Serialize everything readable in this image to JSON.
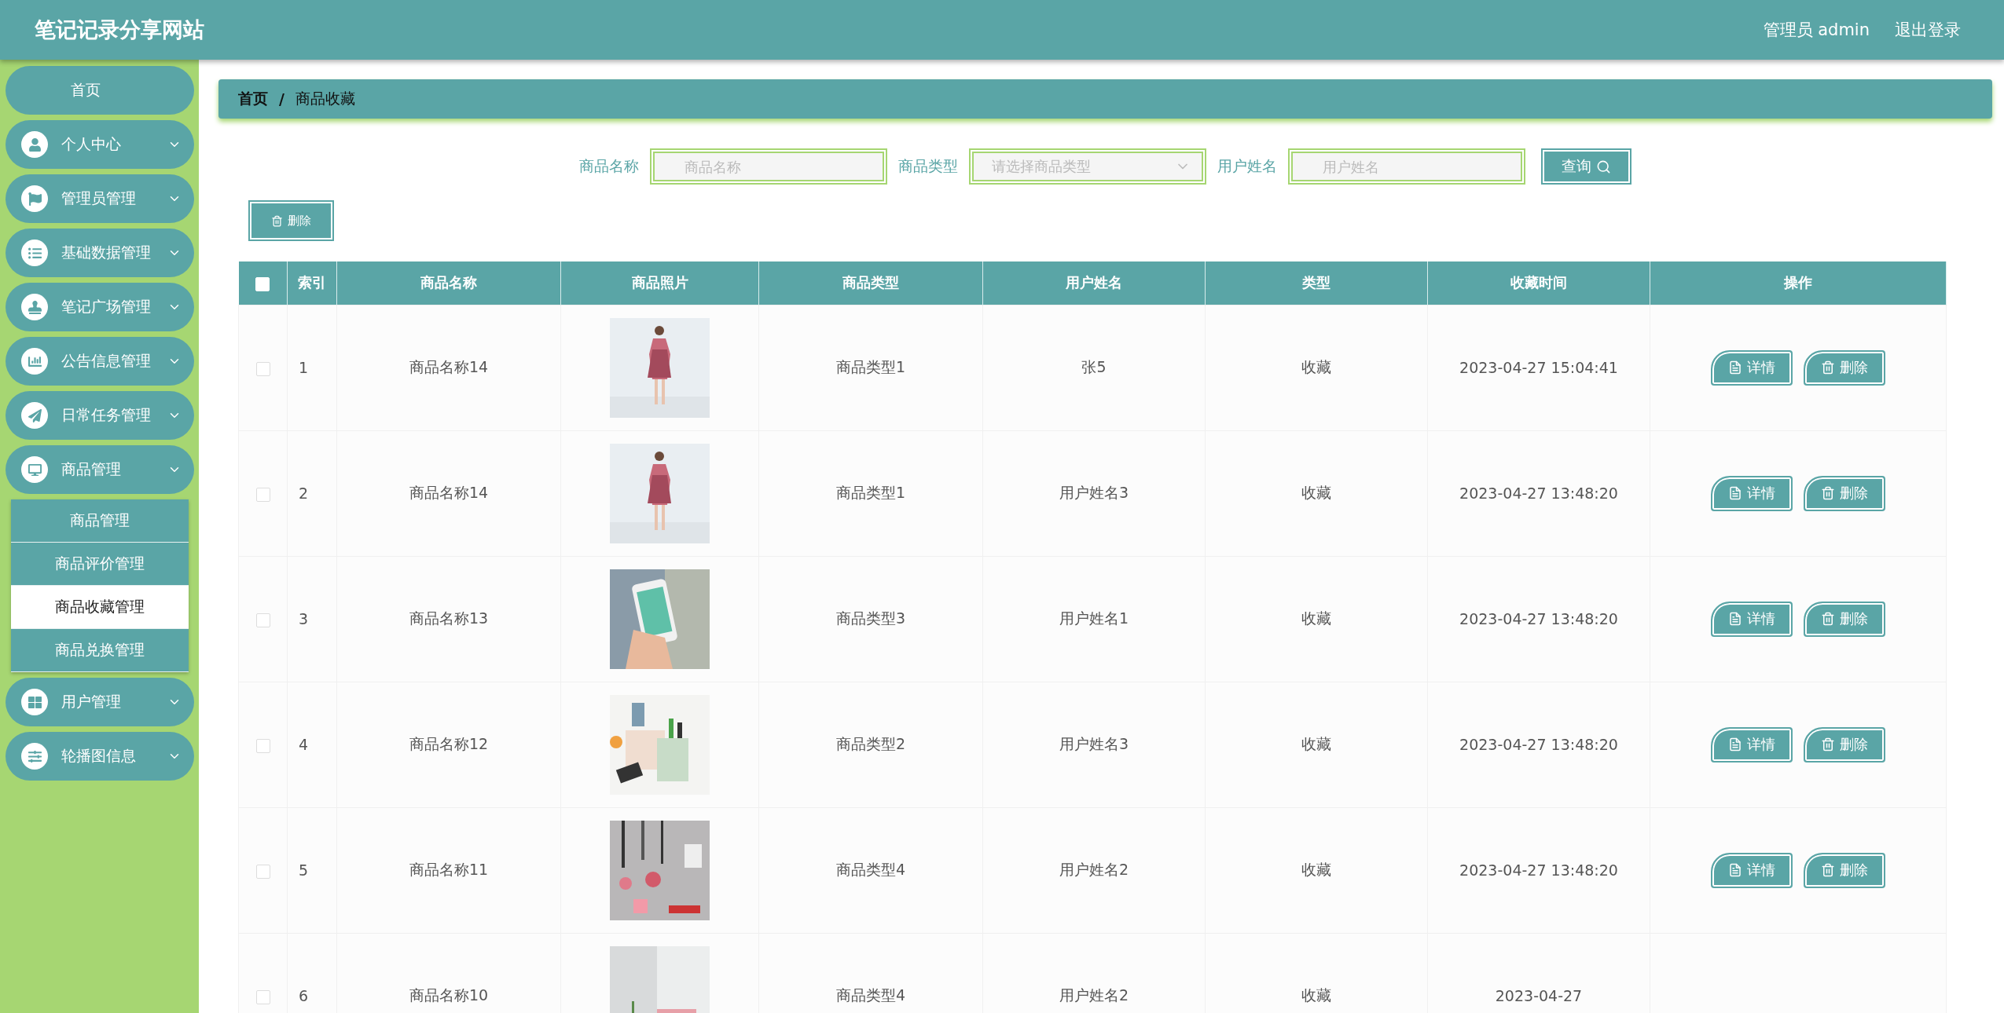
{
  "header": {
    "title": "笔记记录分享网站",
    "user": "管理员 admin",
    "logout": "退出登录"
  },
  "sidebar": {
    "items": [
      {
        "label": "首页"
      },
      {
        "label": "个人中心"
      },
      {
        "label": "管理员管理"
      },
      {
        "label": "基础数据管理"
      },
      {
        "label": "笔记广场管理"
      },
      {
        "label": "公告信息管理"
      },
      {
        "label": "日常任务管理"
      },
      {
        "label": "商品管理",
        "expanded": true,
        "children": [
          {
            "label": "商品管理",
            "selected": false
          },
          {
            "label": "商品评价管理",
            "selected": false
          },
          {
            "label": "商品收藏管理",
            "selected": true
          },
          {
            "label": "商品兑换管理",
            "selected": false
          }
        ]
      },
      {
        "label": "用户管理"
      },
      {
        "label": "轮播图信息"
      }
    ]
  },
  "breadcrumb": {
    "separator": "/",
    "items": [
      "首页",
      "商品收藏"
    ]
  },
  "search": {
    "fields": [
      {
        "kind": "input",
        "label": "商品名称",
        "placeholder": "商品名称"
      },
      {
        "kind": "select",
        "label": "商品类型",
        "placeholder": "请选择商品类型"
      },
      {
        "kind": "input",
        "label": "用户姓名",
        "placeholder": "用户姓名"
      }
    ],
    "button": "查询"
  },
  "delete_button": "删除",
  "table": {
    "select_all": {
      "checked": false
    },
    "columns": [
      "索引",
      "商品名称",
      "商品照片",
      "商品类型",
      "用户姓名",
      "类型",
      "收藏时间",
      "操作"
    ],
    "rows": [
      {
        "checked": false,
        "index": "1",
        "name": "商品名称14",
        "type": "商品类型1",
        "user": "张5",
        "kind": "收藏",
        "time": "2023-04-27 15:04:41",
        "actions": [
          "详情",
          "删除"
        ]
      },
      {
        "checked": false,
        "index": "2",
        "name": "商品名称14",
        "type": "商品类型1",
        "user": "用户姓名3",
        "kind": "收藏",
        "time": "2023-04-27 13:48:20",
        "actions": [
          "详情",
          "删除"
        ]
      },
      {
        "checked": false,
        "index": "3",
        "name": "商品名称13",
        "type": "商品类型3",
        "user": "用户姓名1",
        "kind": "收藏",
        "time": "2023-04-27 13:48:20",
        "actions": [
          "详情",
          "删除"
        ]
      },
      {
        "checked": false,
        "index": "4",
        "name": "商品名称12",
        "type": "商品类型2",
        "user": "用户姓名3",
        "kind": "收藏",
        "time": "2023-04-27 13:48:20",
        "actions": [
          "详情",
          "删除"
        ]
      },
      {
        "checked": false,
        "index": "5",
        "name": "商品名称11",
        "type": "商品类型4",
        "user": "用户姓名2",
        "kind": "收藏",
        "time": "2023-04-27 13:48:20",
        "actions": [
          "详情",
          "删除"
        ]
      },
      {
        "checked": false,
        "index": "6",
        "name": "商品名称10",
        "type": "商品类型4",
        "user": "用户姓名2",
        "kind": "收藏",
        "time": "2023-04-27"
      }
    ]
  }
}
